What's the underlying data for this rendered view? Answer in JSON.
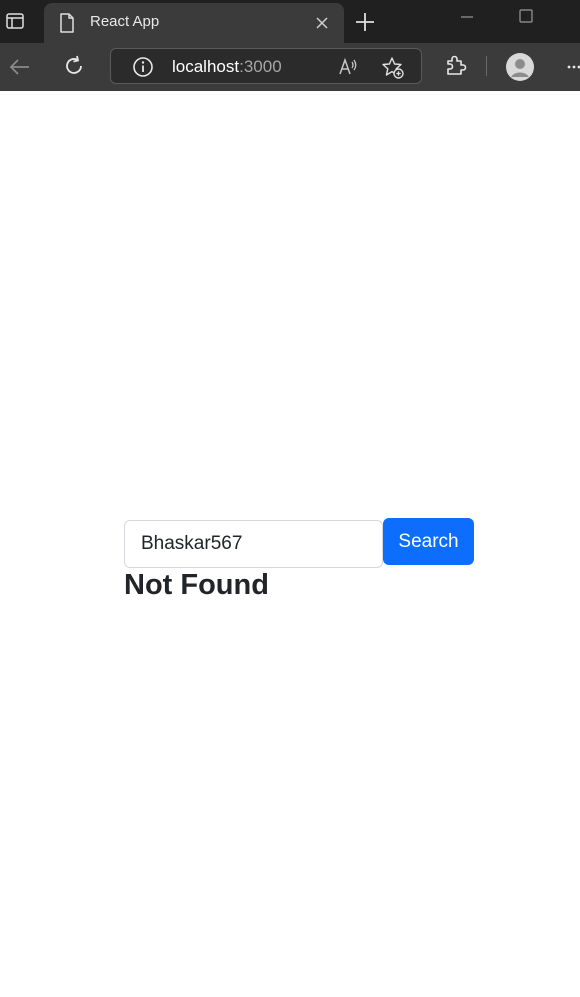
{
  "browser": {
    "tab": {
      "title": "React App"
    },
    "address_bar": {
      "host": "localhost",
      "port": ":3000"
    }
  },
  "search": {
    "input_value": "Bhaskar567",
    "button_label": "Search"
  },
  "result": {
    "message": "Not Found"
  },
  "colors": {
    "chrome_bg": "#202020",
    "toolbar_bg": "#3b3b3b",
    "button_primary": "#0d6efd",
    "text_dark": "#212529"
  }
}
